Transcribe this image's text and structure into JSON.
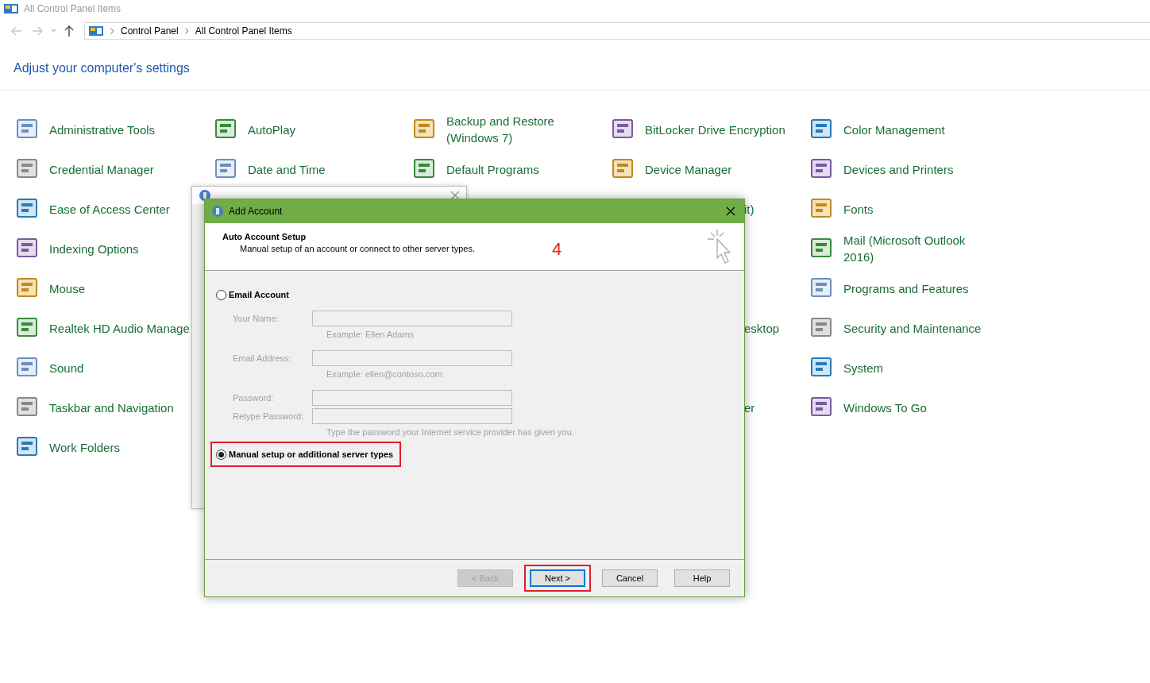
{
  "window": {
    "title": "All Control Panel Items"
  },
  "address_bar": {
    "breadcrumbs": [
      "Control Panel",
      "All Control Panel Items"
    ]
  },
  "heading": "Adjust your computer's settings",
  "rows": [
    {
      "cells": [
        {
          "kind": "item",
          "label": "Administrative Tools"
        },
        {
          "kind": "item",
          "label": "AutoPlay"
        },
        {
          "kind": "item",
          "label": "Backup and Restore (Windows 7)"
        },
        {
          "kind": "item",
          "label": "BitLocker Drive Encryption"
        },
        {
          "kind": "item",
          "label": "Color Management"
        }
      ]
    },
    {
      "cells": [
        {
          "kind": "item",
          "label": "Credential Manager"
        },
        {
          "kind": "item",
          "label": "Date and Time"
        },
        {
          "kind": "item",
          "label": "Default Programs"
        },
        {
          "kind": "item",
          "label": "Device Manager"
        },
        {
          "kind": "item",
          "label": "Devices and Printers"
        }
      ]
    },
    {
      "cells": [
        {
          "kind": "item",
          "label": "Ease of Access Center"
        },
        {
          "kind": "covered"
        },
        {
          "kind": "covered"
        },
        {
          "kind": "clipped",
          "label": "it)"
        },
        {
          "kind": "item",
          "label": "Fonts"
        }
      ]
    },
    {
      "cells": [
        {
          "kind": "item",
          "label": "Indexing Options"
        },
        {
          "kind": "covered"
        },
        {
          "kind": "covered"
        },
        {
          "kind": "covered"
        },
        {
          "kind": "item",
          "label": "Mail (Microsoft Outlook 2016)"
        }
      ]
    },
    {
      "cells": [
        {
          "kind": "item",
          "label": "Mouse"
        },
        {
          "kind": "covered"
        },
        {
          "kind": "covered"
        },
        {
          "kind": "covered"
        },
        {
          "kind": "item",
          "label": "Programs and Features"
        }
      ]
    },
    {
      "cells": [
        {
          "kind": "item",
          "label": "Realtek HD Audio Manage"
        },
        {
          "kind": "covered"
        },
        {
          "kind": "covered"
        },
        {
          "kind": "clipped",
          "label": "esktop"
        },
        {
          "kind": "item",
          "label": "Security and Maintenance"
        }
      ]
    },
    {
      "cells": [
        {
          "kind": "item",
          "label": "Sound"
        },
        {
          "kind": "covered"
        },
        {
          "kind": "covered"
        },
        {
          "kind": "covered"
        },
        {
          "kind": "item",
          "label": "System"
        }
      ]
    },
    {
      "cells": [
        {
          "kind": "item",
          "label": "Taskbar and Navigation"
        },
        {
          "kind": "covered"
        },
        {
          "kind": "covered"
        },
        {
          "kind": "clipped",
          "label": "er"
        },
        {
          "kind": "item",
          "label": "Windows To Go"
        }
      ]
    },
    {
      "cells": [
        {
          "kind": "item",
          "label": "Work Folders"
        }
      ]
    }
  ],
  "dialog": {
    "title": "Add Account",
    "header_title": "Auto Account Setup",
    "header_subtitle": "Manual setup of an account or connect to other server types.",
    "step_marker": "4",
    "options": [
      {
        "label": "Email Account",
        "selected": false,
        "highlighted": false,
        "fields": [
          {
            "label": "Your Name:",
            "disabled": true,
            "hint": "Example: Ellen Adams"
          },
          {
            "label": "Email Address:",
            "disabled": true,
            "hint": "Example: ellen@contoso.com"
          },
          {
            "label": "Password:",
            "disabled": true
          },
          {
            "label": "Retype Password:",
            "disabled": true,
            "hint": "Type the password your Internet service provider has given you."
          }
        ]
      },
      {
        "label": "Manual setup or additional server types",
        "selected": true,
        "highlighted": true
      }
    ],
    "buttons": [
      {
        "label": "< Back",
        "disabled": true,
        "focused": false,
        "highlighted": false
      },
      {
        "label": "Next >",
        "disabled": false,
        "focused": true,
        "highlighted": true
      },
      {
        "label": "Cancel",
        "disabled": false,
        "focused": false,
        "highlighted": false
      },
      {
        "label": "Help",
        "disabled": false,
        "focused": false,
        "highlighted": false
      }
    ]
  }
}
